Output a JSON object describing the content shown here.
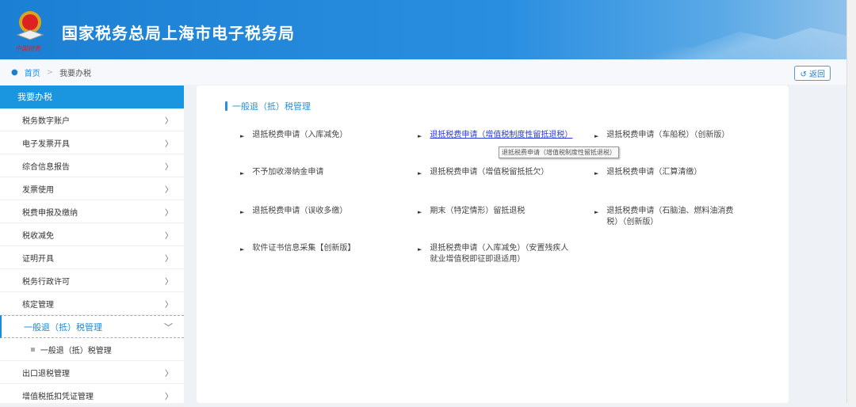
{
  "header": {
    "title": "国家税务总局上海市电子税务局",
    "seal_text": "中国税务"
  },
  "breadcrumb": {
    "home": "首页",
    "separator": ">",
    "current": "我要办税",
    "back_label": "返回"
  },
  "sidebar": {
    "title": "我要办税",
    "items": [
      {
        "label": "税务数字账户"
      },
      {
        "label": "电子发票开具"
      },
      {
        "label": "综合信息报告"
      },
      {
        "label": "发票使用"
      },
      {
        "label": "税费申报及缴纳"
      },
      {
        "label": "税收减免"
      },
      {
        "label": "证明开具"
      },
      {
        "label": "税务行政许可"
      },
      {
        "label": "核定管理"
      }
    ],
    "active": {
      "label": "一般退（抵）税管理",
      "sub": "一般退（抵）税管理"
    },
    "after": [
      {
        "label": "出口退税管理"
      },
      {
        "label": "增值税抵扣凭证管理"
      }
    ],
    "chevron": "〉",
    "chevron_open": "﹀"
  },
  "content": {
    "section_title": "一般退（抵）税管理",
    "links": [
      "退抵税费申请（入库减免）",
      "退抵税费申请（增值税制度性留抵退税）",
      "退抵税费申请（车船税）（创新版）",
      "不予加收滞纳金申请",
      "退抵税费申请（增值税留抵抵欠）",
      "退抵税费申请（汇算清缴）",
      "退抵税费申请（误收多缴）",
      "期末（特定情形）留抵退税",
      "退抵税费申请（石脑油、燃料油消费税）（创新版）",
      "软件证书信息采集【创新版】",
      "退抵税费申请（入库减免）（安置残疾人就业增值税即征即退适用）"
    ],
    "tooltip": "退抵税费申请（增值税制度性留抵退税）"
  }
}
